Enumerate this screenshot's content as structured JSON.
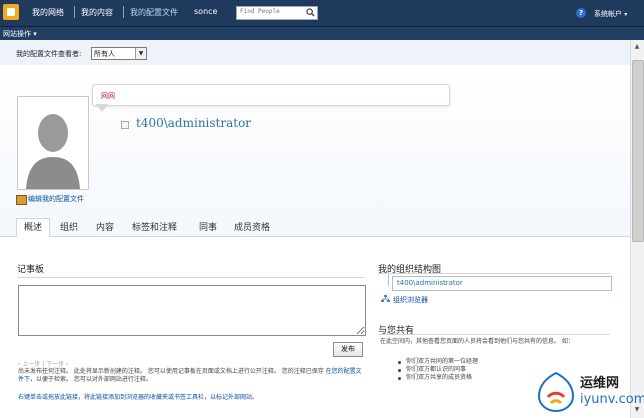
{
  "topnav": {
    "items": [
      "我的网络",
      "我的内容",
      "我的配置文件",
      "sonce"
    ],
    "active_index": 2,
    "search_placeholder": "Find People",
    "account": "系统帐户",
    "account_caret": "▾"
  },
  "subbar": {
    "site_actions": "网站操作 ▾"
  },
  "viewer": {
    "label": "我的配置文件查看者:",
    "selected": "所有人",
    "arrow": "▼"
  },
  "profile": {
    "status_text": "网网",
    "username": "t400\\administrator",
    "edit_link": "编辑我的配置文件"
  },
  "tabs": [
    "概述",
    "组织",
    "内容",
    "标签和注释",
    "同事",
    "成员资格"
  ],
  "notes": {
    "heading": "记事板",
    "post_button": "发布",
    "pager": "‹ 上一步 | 下一步 ›",
    "desc_part1": "尚未发布任何注释。 此处将显示新创建的注释。 您可以使用记事板在页面或文档上进行公开注释。 您的注释已保存 ",
    "desc_link": "在您的配置文件下",
    "desc_part2": "，以便于检索。 您可以对外部网站进行注释。",
    "bookmark_link": "右键单击或拖放此链接，将此链接添加到浏览器的收藏夹或书签工具栏，以标记外部网站。"
  },
  "org": {
    "heading": "我的组织结构图",
    "node": "t400\\administrator",
    "browser_link": "组织浏览器"
  },
  "common": {
    "heading": "与您共有",
    "desc": "在此空间内，其他查看您页面的人员将会看到他们与您共有的信息。 如：",
    "items": [
      "你们双方共同的第一位经理",
      "你们双方都认识的同事",
      "你们双方共享的成员资格"
    ]
  },
  "scrollbar": {
    "up": "▲",
    "down": "▼"
  },
  "watermark": {
    "top": "运维网",
    "bottom": "iyunv.com"
  }
}
